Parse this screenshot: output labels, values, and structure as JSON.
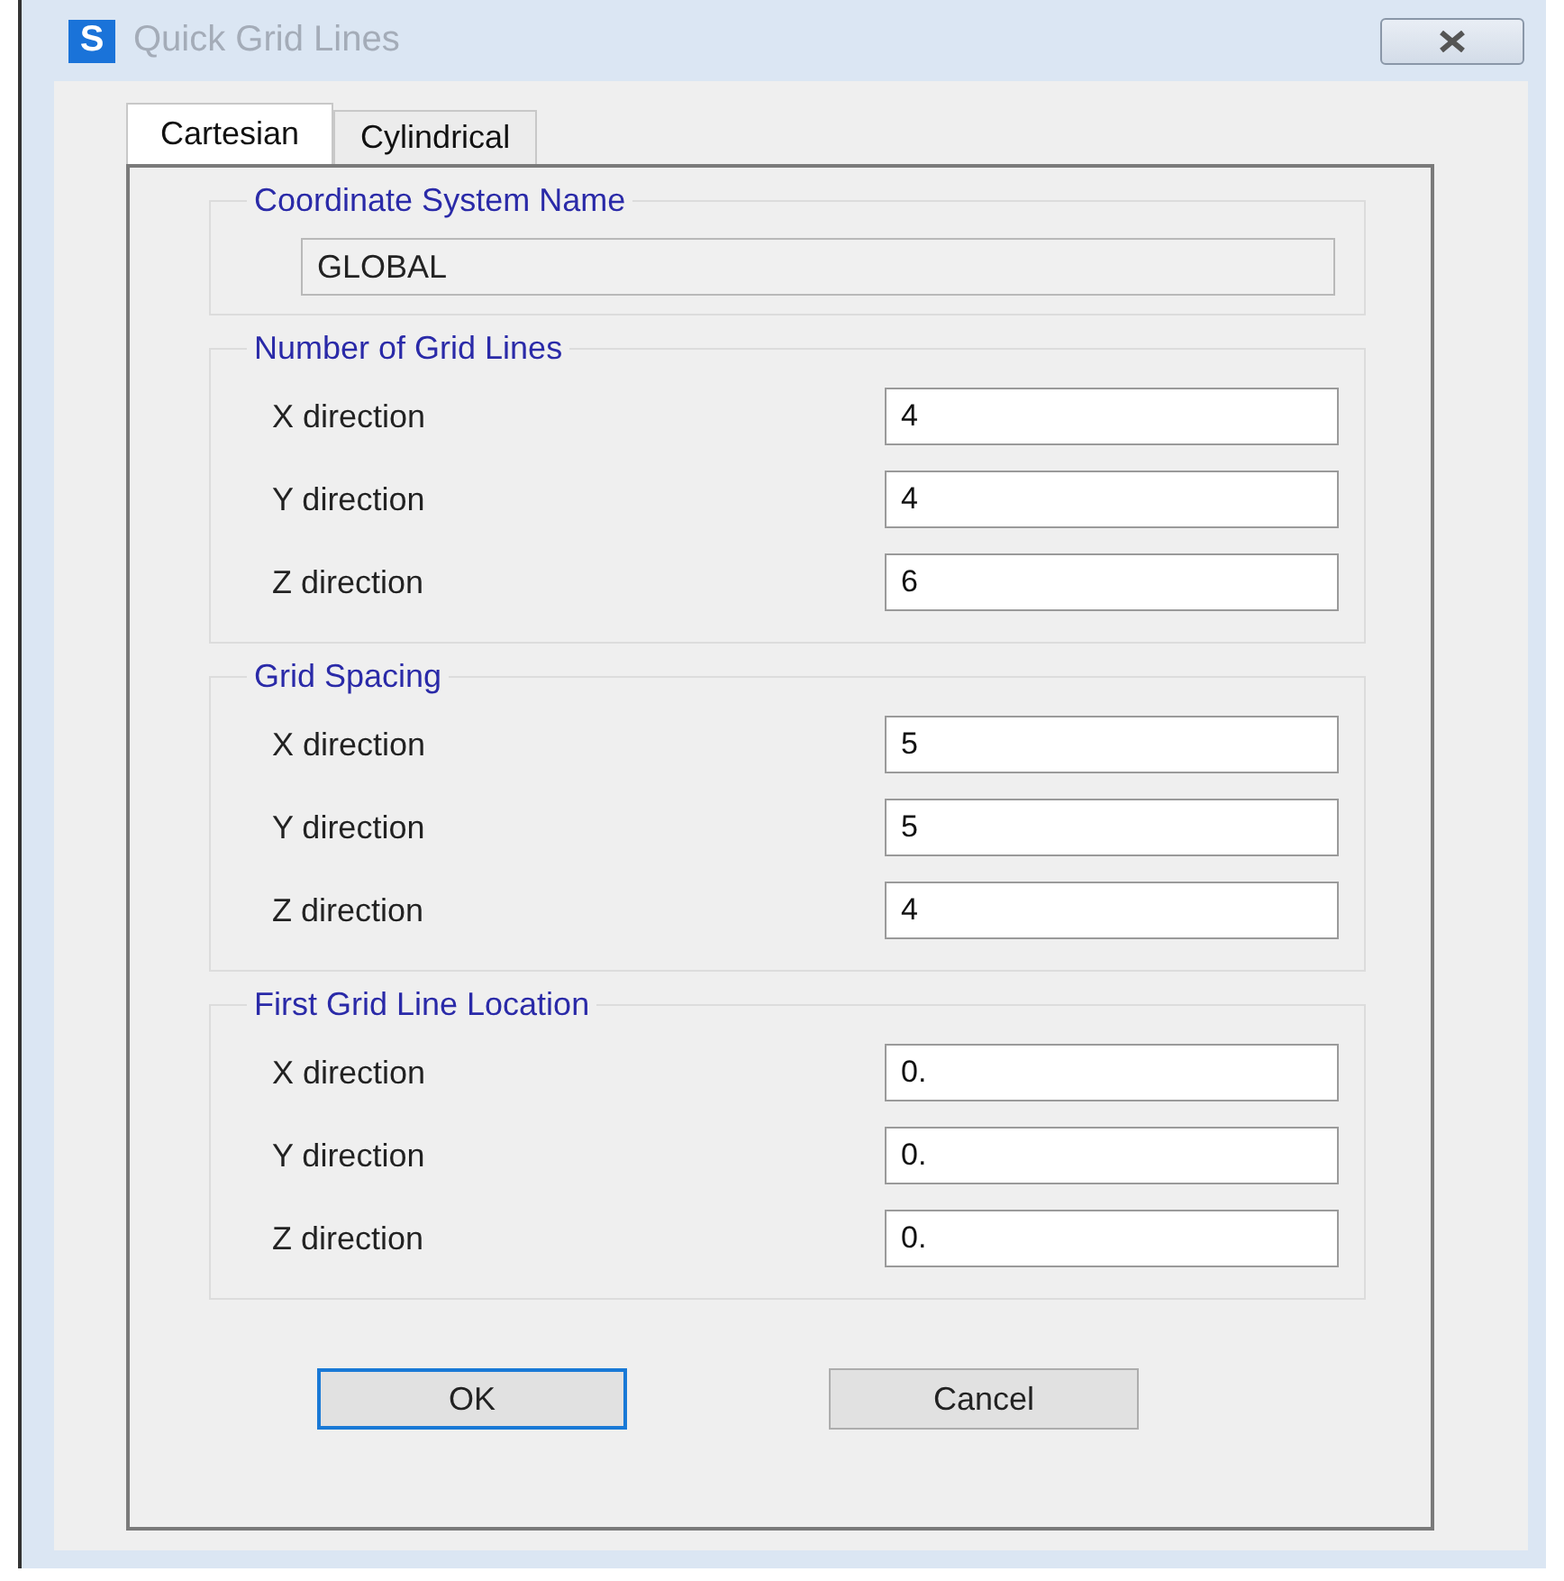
{
  "window": {
    "title": "Quick Grid Lines",
    "app_icon": "S"
  },
  "tabs": [
    {
      "label": "Cartesian",
      "selected": true
    },
    {
      "label": "Cylindrical",
      "selected": false
    }
  ],
  "coordinate_system": {
    "title": "Coordinate System Name",
    "value": "GLOBAL",
    "disabled": true
  },
  "groups": [
    {
      "title": "Number of Grid Lines",
      "rows": [
        {
          "label": "X direction",
          "value": "4"
        },
        {
          "label": "Y direction",
          "value": "4"
        },
        {
          "label": "Z direction",
          "value": "6"
        }
      ]
    },
    {
      "title": "Grid Spacing",
      "rows": [
        {
          "label": "X direction",
          "value": "5"
        },
        {
          "label": "Y direction",
          "value": "5"
        },
        {
          "label": "Z direction",
          "value": "4"
        }
      ]
    },
    {
      "title": "First Grid Line Location",
      "rows": [
        {
          "label": "X direction",
          "value": "0."
        },
        {
          "label": "Y direction",
          "value": "0."
        },
        {
          "label": "Z direction",
          "value": "0."
        }
      ]
    }
  ],
  "buttons": [
    {
      "label": "OK",
      "focused": true
    },
    {
      "label": "Cancel",
      "focused": false
    }
  ]
}
